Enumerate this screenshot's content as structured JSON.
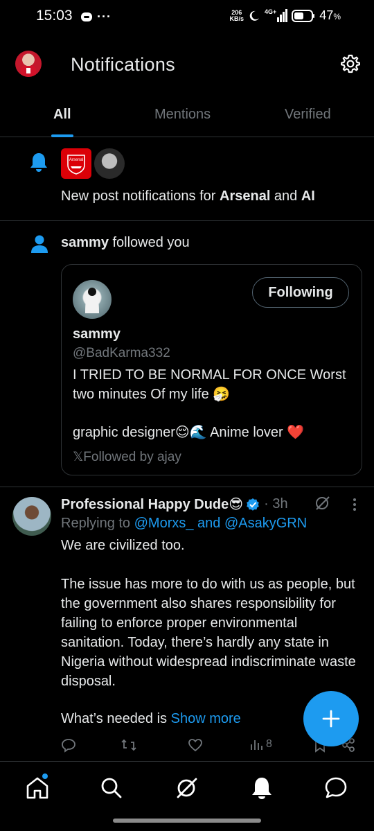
{
  "status_bar": {
    "time": "15:03",
    "net_speed_value": "206",
    "net_speed_unit": "KB/s",
    "network": "4G+",
    "battery": "47",
    "battery_unit": "%"
  },
  "header": {
    "title": "Notifications"
  },
  "tabs": [
    {
      "label": "All",
      "active": true
    },
    {
      "label": "Mentions",
      "active": false
    },
    {
      "label": "Verified",
      "active": false
    }
  ],
  "notification_1": {
    "text_prefix": "New post notifications for ",
    "account_1": "Arsenal",
    "joiner": " and ",
    "account_2": "AI",
    "logo_text": "Arsenal"
  },
  "notification_2": {
    "actor": "sammy",
    "action": " followed you",
    "card": {
      "button_label": "Following",
      "name": "sammy",
      "handle": "@BadKarma332",
      "bio_line_1": "I TRIED TO BE NORMAL FOR ONCE Worst two minutes Of my life 🤧",
      "bio_line_2": "graphic designer😌🌊 Anime lover ❤️",
      "followed_by": "𝕏Followed by ajay"
    }
  },
  "post": {
    "author": "Professional Happy Dude😎",
    "time": "· 3h",
    "reply_prefix": "Replying to ",
    "reply_handles": "@Morxs_ and @AsakyGRN",
    "body": "We are civilized too.\n\nThe issue has more to do with us as people, but the government also shares responsibility for failing to enforce proper environmental sanitation. Today, there’s hardly any state in Nigeria without widespread indiscriminate waste disposal.",
    "show_more_prefix": "What’s needed is ",
    "show_more_label": "Show more",
    "views": "8"
  },
  "bottom_nav": [
    {
      "icon": "home-icon",
      "has_dot": true
    },
    {
      "icon": "search-icon"
    },
    {
      "icon": "grok-icon"
    },
    {
      "icon": "bell-icon",
      "active": true
    },
    {
      "icon": "messages-icon"
    }
  ],
  "colors": {
    "accent": "#1d9bf0",
    "background": "#000000",
    "text": "#e7e9ea",
    "muted": "#71767b",
    "divider": "#2f3336",
    "arsenal_red": "#db0007"
  }
}
